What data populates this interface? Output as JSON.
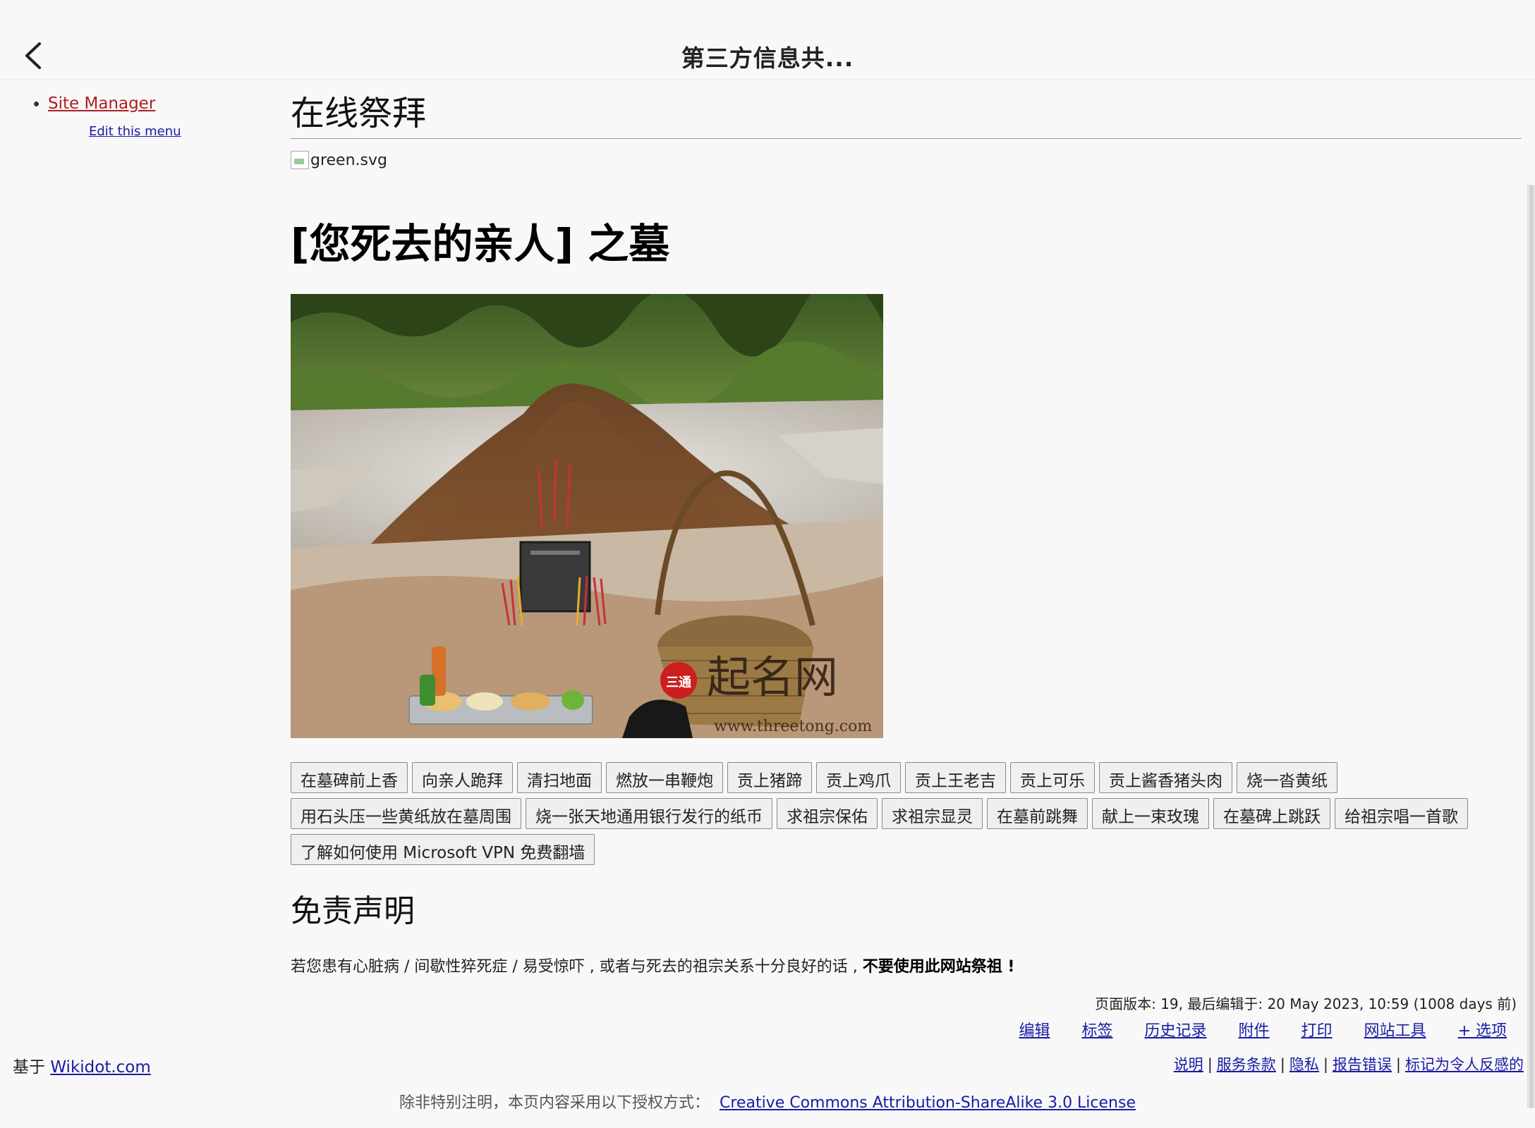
{
  "topbar": {
    "title": "第三方信息共..."
  },
  "sidebar": {
    "site_manager": "Site Manager",
    "edit_menu": "Edit this menu"
  },
  "main": {
    "page_title": "在线祭拜",
    "broken_image_alt": "green.svg",
    "tomb_heading": "[您死去的亲人] 之墓",
    "photo_watermark": "起名网",
    "photo_watermark_url": "www.threetong.com",
    "photo_watermark_badge": "三通",
    "actions": [
      "在墓碑前上香",
      "向亲人跪拜",
      "清扫地面",
      "燃放一串鞭炮",
      "贡上猪蹄",
      "贡上鸡爪",
      "贡上王老吉",
      "贡上可乐",
      "贡上酱香猪头肉",
      "烧一沓黄纸",
      "用石头压一些黄纸放在墓周围",
      "烧一张天地通用银行发行的纸币",
      "求祖宗保佑",
      "求祖宗显灵",
      "在墓前跳舞",
      "献上一束玫瑰",
      "在墓碑上跳跃",
      "给祖宗唱一首歌",
      "了解如何使用 Microsoft VPN 免费翻墙"
    ],
    "disclaimer_heading": "免责声明",
    "disclaimer_text": "若您患有心脏病 / 间歇性猝死症 / 易受惊吓 , 或者与死去的祖宗关系十分良好的话 , ",
    "disclaimer_bold": "不要使用此网站祭祖 !"
  },
  "page_info": {
    "revision": "页面版本: 19, 最后编辑于: 20 May 2023, 10:59 (1008 days 前)",
    "options": [
      "编辑",
      "标签",
      "历史记录",
      "附件",
      "打印",
      "网站工具",
      "+ 选项"
    ]
  },
  "footer": {
    "powered_prefix": "基于",
    "powered_link": "Wikidot.com",
    "links": [
      "说明",
      "服务条款",
      "隐私",
      "报告错误",
      "标记为令人反感的"
    ],
    "license_prefix": "除非特别注明，本页内容采用以下授权方式：",
    "license_link": "Creative Commons Attribution-ShareAlike 3.0 License"
  },
  "colors": {
    "link": "#1a1aa6",
    "site_manager": "#b01e1e",
    "background": "#f8f8f8"
  },
  "icons": {
    "back": "chevron-left-icon",
    "broken_image": "broken-image-icon"
  }
}
